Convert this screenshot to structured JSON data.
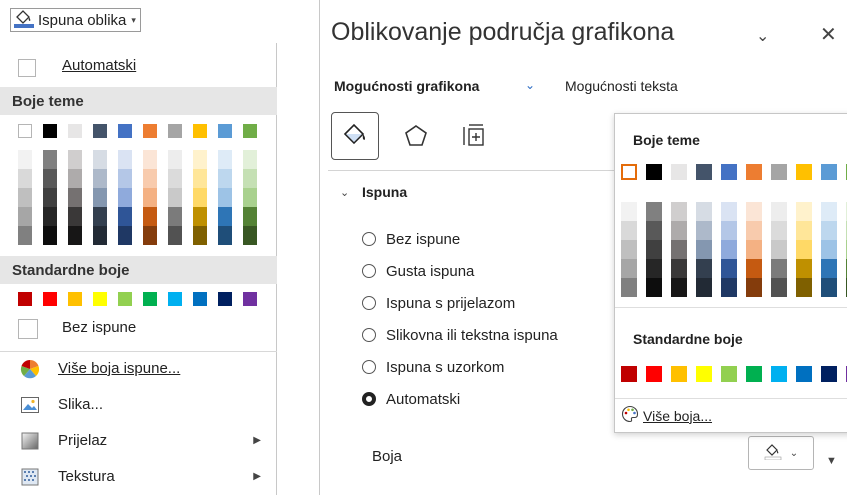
{
  "left_menu": {
    "header_button_label": "Ispuna oblika",
    "automatic_label": "Automatski",
    "theme_colors_heading": "Boje teme",
    "standard_colors_heading": "Standardne boje",
    "no_fill_label": "Bez ispune",
    "more_fill_colors_label": "Više boja ispune...",
    "picture_label": "Slika...",
    "gradient_label": "Prijelaz",
    "texture_label": "Tekstura"
  },
  "right_pane": {
    "title": "Oblikovanje područja grafikona",
    "tab_chart_options": "Mogućnosti grafikona",
    "tab_text_options": "Mogućnosti teksta",
    "section_fill": "Ispuna",
    "radio_options": [
      {
        "label": "Bez ispune",
        "selected": false
      },
      {
        "label": "Gusta ispuna",
        "selected": false
      },
      {
        "label": "Ispuna s prijelazom",
        "selected": false
      },
      {
        "label": "Slikovna ili tekstna ispuna",
        "selected": false
      },
      {
        "label": "Ispuna s uzorkom",
        "selected": false
      },
      {
        "label": "Automatski",
        "selected": true
      }
    ],
    "color_label": "Boja"
  },
  "color_popup": {
    "theme_colors_heading": "Boje teme",
    "standard_colors_heading": "Standardne boje",
    "more_colors_label": "Više boja..."
  },
  "theme_colors": [
    "#ffffff",
    "#000000",
    "#e7e6e6",
    "#44546a",
    "#4472c4",
    "#ed7d31",
    "#a5a5a5",
    "#ffc000",
    "#5b9bd5",
    "#70ad47"
  ],
  "theme_shades": [
    [
      "#f2f2f2",
      "#d9d9d9",
      "#bfbfbf",
      "#a6a6a6",
      "#808080"
    ],
    [
      "#808080",
      "#595959",
      "#404040",
      "#262626",
      "#0d0d0d"
    ],
    [
      "#d0cece",
      "#aeabab",
      "#757171",
      "#3a3838",
      "#171616"
    ],
    [
      "#d6dce4",
      "#adb9ca",
      "#8497b0",
      "#333f4f",
      "#222a35"
    ],
    [
      "#dae3f3",
      "#b4c7e7",
      "#8faadc",
      "#2f5597",
      "#1f3864"
    ],
    [
      "#fbe5d6",
      "#f8cbad",
      "#f4b183",
      "#c55a11",
      "#843c0c"
    ],
    [
      "#ededed",
      "#dbdbdb",
      "#c9c9c9",
      "#7b7b7b",
      "#525252"
    ],
    [
      "#fff2cc",
      "#ffe699",
      "#ffd966",
      "#bf9000",
      "#7f6000"
    ],
    [
      "#deebf7",
      "#bdd7ee",
      "#9dc3e6",
      "#2e75b6",
      "#1f4e79"
    ],
    [
      "#e2f0d9",
      "#c5e0b4",
      "#a9d18e",
      "#548235",
      "#385723"
    ]
  ],
  "standard_colors": [
    "#c00000",
    "#ff0000",
    "#ffc000",
    "#ffff00",
    "#92d050",
    "#00b050",
    "#00b0f0",
    "#0070c0",
    "#002060",
    "#7030a0"
  ],
  "popup_visible_columns": 10,
  "popup_selected_color": "#ffffff"
}
